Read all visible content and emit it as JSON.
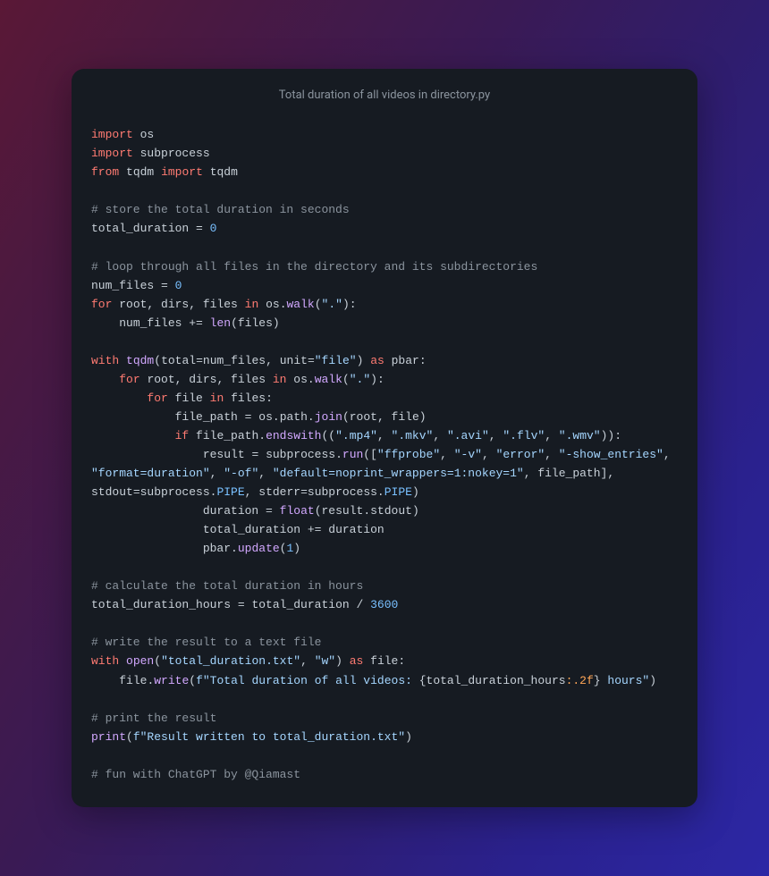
{
  "title": "Total duration of all videos in directory.py",
  "code": {
    "l1": {
      "kw_import": "import",
      "sp": " ",
      "mod": "os"
    },
    "l2": {
      "kw_import": "import",
      "sp": " ",
      "mod": "subprocess"
    },
    "l3": {
      "kw_from": "from",
      "sp1": " ",
      "mod": "tqdm",
      "sp2": " ",
      "kw_import": "import",
      "sp3": " ",
      "name": "tqdm"
    },
    "l5": {
      "cm": "# store the total duration in seconds"
    },
    "l6": {
      "id": "total_duration ",
      "op": "=",
      "sp": " ",
      "num": "0"
    },
    "l8": {
      "cm": "# loop through all files in the directory and its subdirectories"
    },
    "l9": {
      "id": "num_files ",
      "op": "=",
      "sp": " ",
      "num": "0"
    },
    "l10": {
      "kw_for": "for",
      "sp1": " ",
      "ids": "root, dirs, files ",
      "kw_in": "in",
      "sp2": " ",
      "mod": "os",
      "dot": ".",
      "fn": "walk",
      "lp": "(",
      "str": "\".\"",
      "rp": ")",
      "colon": ":"
    },
    "l11": {
      "indent": "    ",
      "id": "num_files ",
      "op": "+=",
      "sp": " ",
      "fn": "len",
      "lp": "(",
      "arg": "files",
      "rp": ")"
    },
    "l13": {
      "kw_with": "with",
      "sp1": " ",
      "fn": "tqdm",
      "lp": "(",
      "kw1": "total",
      "eq1": "=",
      "val1": "num_files",
      "com": ", ",
      "kw2": "unit",
      "eq2": "=",
      "str": "\"file\"",
      "rp": ")",
      "sp2": " ",
      "kw_as": "as",
      "sp3": " ",
      "var": "pbar",
      "colon": ":"
    },
    "l14": {
      "indent": "    ",
      "kw_for": "for",
      "sp1": " ",
      "ids": "root, dirs, files ",
      "kw_in": "in",
      "sp2": " ",
      "mod": "os",
      "dot": ".",
      "fn": "walk",
      "lp": "(",
      "str": "\".\"",
      "rp": ")",
      "colon": ":"
    },
    "l15": {
      "indent": "        ",
      "kw_for": "for",
      "sp1": " ",
      "id": "file ",
      "kw_in": "in",
      "sp2": " ",
      "src": "files",
      "colon": ":"
    },
    "l16": {
      "indent": "            ",
      "id": "file_path ",
      "op": "=",
      "sp": " ",
      "mod": "os",
      "d1": ".",
      "sub": "path",
      "d2": ".",
      "fn": "join",
      "lp": "(",
      "args": "root, file",
      "rp": ")"
    },
    "l17": {
      "indent": "            ",
      "kw_if": "if",
      "sp": " ",
      "obj": "file_path",
      "dot": ".",
      "fn": "endswith",
      "lp": "((",
      "s1": "\".mp4\"",
      "c1": ", ",
      "s2": "\".mkv\"",
      "c2": ", ",
      "s3": "\".avi\"",
      "c3": ", ",
      "s4": "\".flv\"",
      "c4": ", ",
      "s5": "\".wmv\"",
      "rp": "))",
      "colon": ":"
    },
    "l18": {
      "indent": "                ",
      "id": "result ",
      "op": "=",
      "sp": " ",
      "mod": "subprocess",
      "dot": ".",
      "fn": "run",
      "lp": "([",
      "s1": "\"ffprobe\"",
      "c1": ", ",
      "s2": "\"-v\"",
      "c2": ", ",
      "s3": "\"error\"",
      "c3": ", ",
      "s4": "\"-show_entries\"",
      "c4": ", ",
      "s5": "\"format=duration\"",
      "c5": ", ",
      "s6": "\"-of\"",
      "c6": ", ",
      "s7": "\"default=noprint_wrappers=1:nokey=1\"",
      "c7": ", ",
      "arg": "file_path",
      "rb": "]",
      "c8": ", ",
      "kw1": "stdout",
      "eq1": "=",
      "mod2": "subprocess",
      "d2": ".",
      "cst1": "PIPE",
      "c9": ", ",
      "kw2": "stderr",
      "eq2": "=",
      "mod3": "subprocess",
      "d3": ".",
      "cst2": "PIPE",
      "rp": ")"
    },
    "l19": {
      "indent": "                ",
      "id": "duration ",
      "op": "=",
      "sp": " ",
      "fn": "float",
      "lp": "(",
      "arg": "result",
      "dot": ".",
      "attr": "stdout",
      "rp": ")"
    },
    "l20": {
      "indent": "                ",
      "id": "total_duration ",
      "op": "+=",
      "sp": " ",
      "val": "duration"
    },
    "l21": {
      "indent": "                ",
      "obj": "pbar",
      "dot": ".",
      "fn": "update",
      "lp": "(",
      "num": "1",
      "rp": ")"
    },
    "l23": {
      "cm": "# calculate the total duration in hours"
    },
    "l24": {
      "id": "total_duration_hours ",
      "op": "=",
      "sp": " ",
      "val": "total_duration ",
      "div": "/",
      "sp2": " ",
      "num": "3600"
    },
    "l26": {
      "cm": "# write the result to a text file"
    },
    "l27": {
      "kw_with": "with",
      "sp1": " ",
      "fn": "open",
      "lp": "(",
      "s1": "\"total_duration.txt\"",
      "c1": ", ",
      "s2": "\"w\"",
      "rp": ")",
      "sp2": " ",
      "kw_as": "as",
      "sp3": " ",
      "var": "file",
      "colon": ":"
    },
    "l28": {
      "indent": "    ",
      "obj": "file",
      "dot": ".",
      "fn": "write",
      "lp": "(",
      "fpre": "f\"Total duration of all videos: ",
      "lb": "{",
      "expr": "total_duration_hours",
      "spec": ":.2f",
      "rb": "}",
      "ftail": " hours\"",
      "rp": ")"
    },
    "l30": {
      "cm": "# print the result"
    },
    "l31": {
      "fn": "print",
      "lp": "(",
      "fpre": "f\"Result written to total_duration.txt\"",
      "rp": ")"
    },
    "l33": {
      "cm": "# fun with ChatGPT by @Qiamast"
    }
  }
}
